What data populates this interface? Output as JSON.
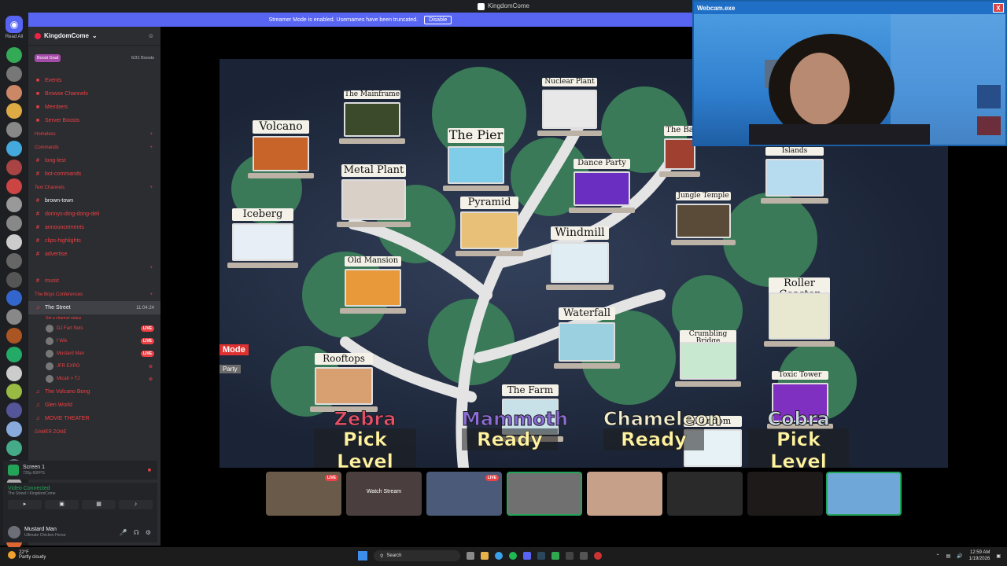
{
  "window": {
    "title": "KingdomCome"
  },
  "streamer_mode": {
    "message": "Streamer Mode is enabled. Usernames have been truncated.",
    "button": "Disable"
  },
  "rail": {
    "read_all": "Read All"
  },
  "sidebar": {
    "server_name": "KingdomCome",
    "boost_goal": "Boost Goal",
    "boosts": "6/31 Boosts",
    "items": [
      {
        "kind": "row",
        "label": "Events",
        "icon": "calendar-icon"
      },
      {
        "kind": "row",
        "label": "Browse Channels",
        "icon": "browse-icon"
      },
      {
        "kind": "row",
        "label": "Members",
        "icon": "members-icon"
      },
      {
        "kind": "row",
        "label": "Server Boosts",
        "icon": "boost-icon"
      },
      {
        "kind": "cat",
        "label": "Homeless"
      },
      {
        "kind": "cat",
        "label": "Commands"
      },
      {
        "kind": "row",
        "label": "long-lest",
        "icon": "hash-icon"
      },
      {
        "kind": "row",
        "label": "bot-commands",
        "icon": "hash-icon"
      },
      {
        "kind": "cat",
        "label": "Text Channels"
      },
      {
        "kind": "row",
        "label": "brown-town",
        "icon": "hash-icon",
        "white": true
      },
      {
        "kind": "row",
        "label": "donnys-ding-dong-deli",
        "icon": "hash-icon"
      },
      {
        "kind": "row",
        "label": "announcements",
        "icon": "hash-icon"
      },
      {
        "kind": "row",
        "label": "clips-highlights",
        "icon": "hash-icon"
      },
      {
        "kind": "row",
        "label": "advertise",
        "icon": "hash-icon"
      },
      {
        "kind": "cat",
        "label": ""
      },
      {
        "kind": "row",
        "label": "music",
        "icon": "hash-icon"
      },
      {
        "kind": "cat",
        "label": "The Boys Conferences"
      }
    ],
    "current_voice": {
      "label": "The Street",
      "time": "11:04:24",
      "status": "Set a channel status"
    },
    "voice_users": [
      {
        "name": "DJ Fart Nuts",
        "live": "LIVE"
      },
      {
        "name": "f Wik",
        "live": "LIVE"
      },
      {
        "name": "Mustard Man",
        "live": "LIVE"
      },
      {
        "name": "JFR EXPO",
        "live": ""
      },
      {
        "name": "Micah > TJ",
        "live": ""
      }
    ],
    "more_voice": [
      {
        "label": "The Volcano Bong"
      },
      {
        "label": "Glen World"
      },
      {
        "label": "MOVIE THEATER"
      }
    ],
    "last_cat": "GAMER ZONE"
  },
  "screen_share": {
    "title": "Screen 1",
    "sub": "720p 60FPS"
  },
  "voice_status": {
    "title": "Video Connected",
    "sub": "The Street / KingdomCome"
  },
  "user": {
    "name": "Mustard Man",
    "status": "Ultimate Chicken Horse"
  },
  "game": {
    "levels": [
      {
        "name": "Volcano"
      },
      {
        "name": "The Mainframe"
      },
      {
        "name": "The Pier"
      },
      {
        "name": "Nuclear Plant"
      },
      {
        "name": "The Ba"
      },
      {
        "name": "Islands"
      },
      {
        "name": "Metal Plant"
      },
      {
        "name": "Dance Party"
      },
      {
        "name": "Iceberg"
      },
      {
        "name": "Pyramid"
      },
      {
        "name": "Jungle Temple"
      },
      {
        "name": "Windmill"
      },
      {
        "name": "Old Mansion"
      },
      {
        "name": "Roller Coaster"
      },
      {
        "name": "Waterfall"
      },
      {
        "name": "Crumbling Bridge"
      },
      {
        "name": "Rooftops"
      },
      {
        "name": "The Farm"
      },
      {
        "name": "Toxic Tower"
      },
      {
        "name": "Random"
      }
    ],
    "mode_tag": "Mode",
    "party_tag": "Party",
    "players": [
      {
        "name": "Zebra",
        "state": "Pick Level",
        "color": "#e8506a"
      },
      {
        "name": "Mammoth",
        "state": "Ready",
        "color": "#8a6bd8"
      },
      {
        "name": "Chameleon",
        "state": "Ready",
        "color": "#f2eecf"
      },
      {
        "name": "Cobra",
        "state": "Pick Level",
        "color": "#c9d5e0"
      }
    ]
  },
  "tiles": [
    {
      "label": "",
      "live": "LIVE"
    },
    {
      "label": "Watch Stream",
      "live": ""
    },
    {
      "label": "",
      "live": "LIVE"
    },
    {
      "label": "",
      "live": ""
    },
    {
      "label": "",
      "live": ""
    },
    {
      "label": "",
      "live": ""
    },
    {
      "label": "",
      "live": ""
    },
    {
      "label": "",
      "live": ""
    }
  ],
  "webcam": {
    "title": "Webcam.exe",
    "close": "X"
  },
  "taskbar": {
    "weather_temp": "22°F",
    "weather_desc": "Partly cloudy",
    "search": "Search",
    "time": "12:59 AM",
    "date": "1/19/2026"
  },
  "colors": {
    "accent": "#5865f2",
    "live": "#ed4245",
    "channel": "#f23f42",
    "voice": "#23a559"
  }
}
